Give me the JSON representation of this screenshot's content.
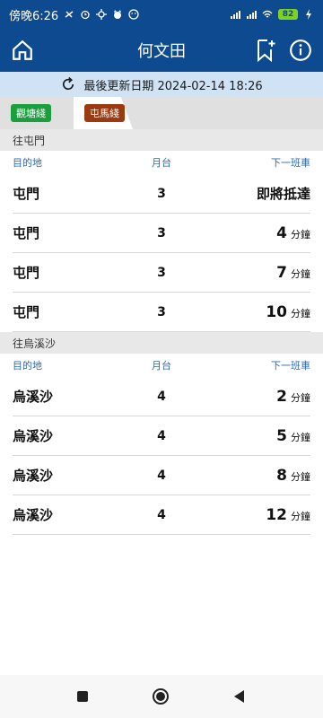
{
  "statusbar": {
    "time": "傍晚6:26",
    "battery": "82",
    "icons_left": [
      "data-saver-icon",
      "alarm-icon",
      "location-icon",
      "cat-icon",
      "emoji-icon"
    ],
    "icons_right": [
      "signal-icon",
      "signal-icon",
      "wifi-icon",
      "battery-icon",
      "charging-icon"
    ]
  },
  "appbar": {
    "title": "何文田"
  },
  "update": {
    "text": "最後更新日期 2024-02-14 18:26"
  },
  "tabs": [
    {
      "label": "觀塘綫",
      "color": "#1a9e3e"
    },
    {
      "label": "屯馬綫",
      "color": "#9a3a10"
    }
  ],
  "columns": {
    "destination": "目的地",
    "platform": "月台",
    "next": "下一班車"
  },
  "sections": [
    {
      "title": "往屯門",
      "rows": [
        {
          "dest": "屯門",
          "platform": "3",
          "eta": "即將抵達",
          "unit": ""
        },
        {
          "dest": "屯門",
          "platform": "3",
          "eta": "4",
          "unit": "分鐘"
        },
        {
          "dest": "屯門",
          "platform": "3",
          "eta": "7",
          "unit": "分鐘"
        },
        {
          "dest": "屯門",
          "platform": "3",
          "eta": "10",
          "unit": "分鐘"
        }
      ]
    },
    {
      "title": "往烏溪沙",
      "rows": [
        {
          "dest": "烏溪沙",
          "platform": "4",
          "eta": "2",
          "unit": "分鐘"
        },
        {
          "dest": "烏溪沙",
          "platform": "4",
          "eta": "5",
          "unit": "分鐘"
        },
        {
          "dest": "烏溪沙",
          "platform": "4",
          "eta": "8",
          "unit": "分鐘"
        },
        {
          "dest": "烏溪沙",
          "platform": "4",
          "eta": "12",
          "unit": "分鐘"
        }
      ]
    }
  ]
}
